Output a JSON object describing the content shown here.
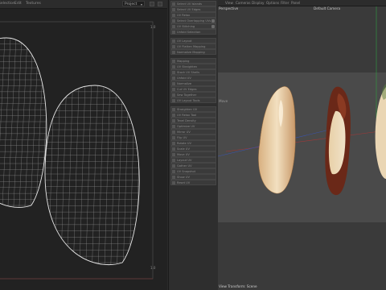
{
  "uv_editor": {
    "menu": [
      "Selection",
      "Edit",
      "Textures"
    ],
    "space_dropdown": "Project",
    "tick_top_right": "1.0",
    "tick_bottom_right": "1.0"
  },
  "panel": {
    "rows": [
      "Select UV Islands",
      "Select UV Edges",
      "UV Relax",
      "Select Overlapping UVs",
      "UV Stitching",
      "Unfold Selection",
      "UV Layout",
      "UV Flatten Mapping",
      "Normalize Mapping",
      "Mapping",
      "UV Straighten",
      "Stack UV Shells",
      "Unfold UV",
      "Normalize",
      "Cut UV Edges",
      "Sew Together",
      "UV Layout Tools",
      "Straighten UV",
      "UV Relax Tool",
      "Texel Density",
      "Optimize UV",
      "Mirror UV",
      "Flip UV",
      "Rotate UV",
      "Scale UV",
      "Move UV",
      "Layout UV",
      "Gather UV",
      "UV Snapshot",
      "Show UV",
      "Reset UV"
    ]
  },
  "viewport": {
    "menu": [
      "View",
      "Cameras",
      "Display",
      "Options",
      "Filter",
      "Panel"
    ],
    "view_name": "Perspective",
    "camera": "Default Camera",
    "move_label": "Move",
    "status": "View Transform: Scene"
  },
  "colors": {
    "uv_outline": "#e8e8e8",
    "uv_grid": "#8c8c8c",
    "axis_red": "#b03030",
    "axis_blue": "#3050b0",
    "axis_green": "#30a040"
  }
}
